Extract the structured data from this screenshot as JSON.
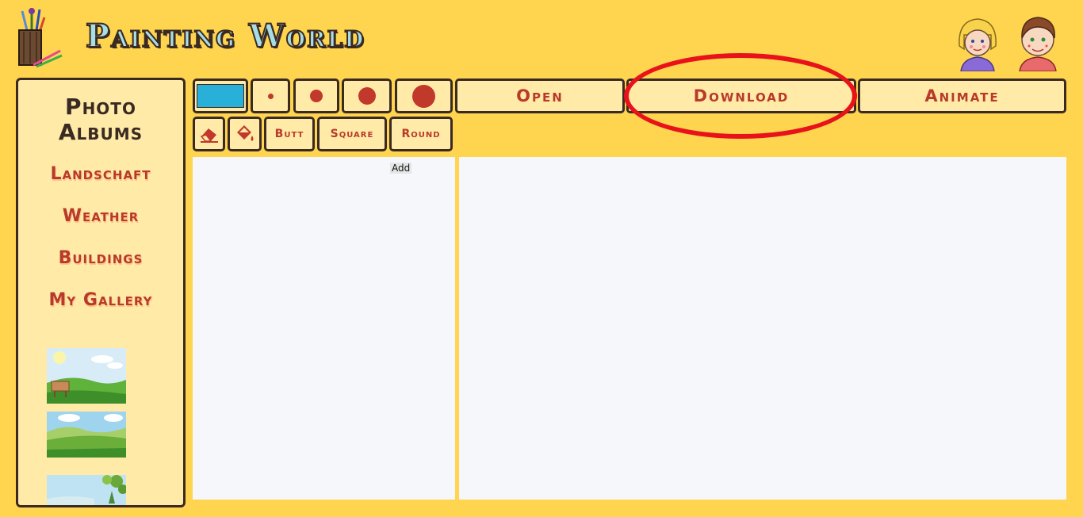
{
  "app": {
    "title": "Painting World"
  },
  "sidebar": {
    "title_line1": "Photo",
    "title_line2": "Albums",
    "albums": [
      {
        "label": "Landschaft"
      },
      {
        "label": "Weather"
      },
      {
        "label": "Buildings"
      },
      {
        "label": "My Gallery"
      }
    ]
  },
  "toolbar": {
    "current_color": "#29b0d8",
    "open_label": "Open",
    "download_label": "Download",
    "animate_label": "Animate",
    "butt_label": "Butt",
    "square_label": "Square",
    "round_label": "Round"
  },
  "layers": {
    "add_label": "Add"
  },
  "colors": {
    "background": "#ffd54f",
    "panel": "#ffeaa8",
    "accent_text": "#b83a2a",
    "border": "#3a2a22",
    "highlight": "#e8121a"
  },
  "icons": {
    "logo": "pencil-cup-icon",
    "eraser": "eraser-icon",
    "fill": "paint-bucket-icon",
    "girl_avatar": "girl-avatar-icon",
    "boy_avatar": "boy-avatar-icon"
  }
}
